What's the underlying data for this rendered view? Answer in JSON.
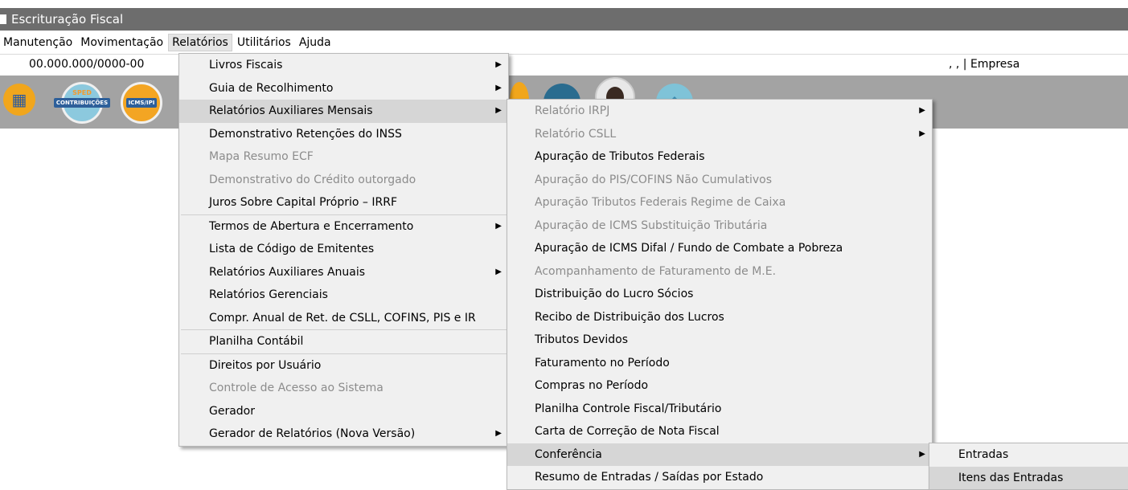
{
  "window": {
    "title": "Escrituração Fiscal"
  },
  "menubar": {
    "items": [
      {
        "label": "Manutenção"
      },
      {
        "label": "Movimentação"
      },
      {
        "label": "Relatórios"
      },
      {
        "label": "Utilitários"
      },
      {
        "label": "Ajuda"
      }
    ]
  },
  "infobar": {
    "cnpj": "00.000.000/0000-00",
    "empresa": ", , | Empresa"
  },
  "toolbar": {
    "sped_top": "SPED",
    "sped_label": "CONTRIBUIÇÕES",
    "icms_label": "ICMS/IPI"
  },
  "relatorios_menu": {
    "items": [
      "Livros Fiscais",
      "Guia de Recolhimento",
      "Relatórios Auxiliares Mensais",
      "Demonstrativo Retenções do INSS",
      "Mapa Resumo ECF",
      "Demonstrativo do Crédito outorgado",
      "Juros Sobre Capital Próprio – IRRF",
      "Termos de Abertura e Encerramento",
      "Lista de Código de Emitentes",
      "Relatórios Auxiliares Anuais",
      "Relatórios Gerenciais",
      "Compr. Anual de Ret. de CSLL, COFINS, PIS e IR",
      "Planilha Contábil",
      "Direitos por Usuário",
      "Controle de Acesso ao Sistema",
      "Gerador",
      "Gerador de Relatórios (Nova Versão)"
    ]
  },
  "mensais_menu": {
    "items": [
      "Relatório IRPJ",
      "Relatório CSLL",
      "Apuração de Tributos Federais",
      "Apuração do PIS/COFINS Não Cumulativos",
      "Apuração Tributos Federais Regime de Caixa",
      "Apuração de ICMS Substituição Tributária",
      "Apuração de ICMS Difal / Fundo de Combate a Pobreza",
      "Acompanhamento de Faturamento de M.E.",
      "Distribuição do Lucro Sócios",
      "Recibo de Distribuição dos Lucros",
      "Tributos Devidos",
      "Faturamento no Período",
      "Compras no Período",
      "Planilha Controle Fiscal/Tributário",
      "Carta de Correção de Nota Fiscal",
      "Conferência",
      "Resumo de Entradas / Saídas por Estado"
    ]
  },
  "conferencia_menu": {
    "items": [
      "Entradas",
      "Itens das Entradas"
    ]
  }
}
